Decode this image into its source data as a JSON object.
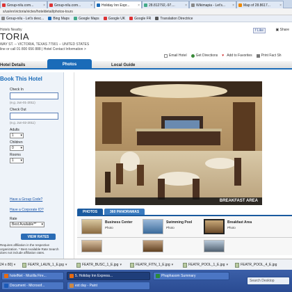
{
  "browser": {
    "tabs": [
      {
        "label": "Group-nilu.com...",
        "color": "#d33"
      },
      {
        "label": "Group-nilu.com...",
        "color": "#d33"
      },
      {
        "label": "Holiday Inn Expr...",
        "color": "#1a6bb8",
        "active": true
      },
      {
        "label": "28.812792,-97....",
        "color": "#4a8"
      },
      {
        "label": "Wikimapia - Let's...",
        "color": "#888"
      },
      {
        "label": "Map of 28.8617...",
        "color": "#e80"
      }
    ],
    "address": "s/us/en/victoria/victex/hoteldetail/photos-tours",
    "bookmarks": [
      {
        "label": "Group-nilu - Let's desc...",
        "color": "#888"
      },
      {
        "label": "Bing Maps",
        "color": "#1a6bb8"
      },
      {
        "label": "Google Maps",
        "color": "#4a8"
      },
      {
        "label": "Google UK",
        "color": "#d33"
      },
      {
        "label": "Google FR",
        "color": "#d33"
      },
      {
        "label": "Translation Directrice",
        "color": "#555"
      }
    ]
  },
  "page": {
    "hotels_nearby": "Hotels Nearby",
    "title": "TORIA",
    "address": "WAY ST. -- VICTORIA, TEXAS 77901 -- UNITED STATES",
    "phone": "line or call 01 800 656 888  |  Hotel Contact Information >",
    "like": "Like",
    "share": "Share",
    "actions": [
      "Email Hotel",
      "Get Directions",
      "Add to Favorites",
      "Print Fact Sh"
    ],
    "nav": {
      "details": "Hotel Details",
      "photos": "Photos",
      "local": "Local Guide"
    }
  },
  "booking": {
    "title": "Book This Hotel",
    "checkin_label": "Check In",
    "checkin_hint": "(e.g. Jun-01-2011)",
    "checkout_label": "Check Out",
    "checkout_hint": "(e.g. Jun-02-2011)",
    "adults_label": "Adults",
    "adults_value": "1",
    "children_label": "Children",
    "children_value": "0",
    "rooms_label": "Rooms",
    "rooms_value": "1",
    "group_code": "Have a Group Code?",
    "corporate_id": "Have a Corporate ID?",
    "rate_label": "Rate",
    "rate_value": "Best Available**",
    "view_rates": "VIEW RATES",
    "disclaimer": "Requires affiliation in the respective organization. * Best Available Rate Search does not include affiliation rates."
  },
  "photos": {
    "caption": "BREAKFAST AREA",
    "tabs": [
      "PHOTOS",
      "360 PANORAMAS"
    ],
    "thumbs": [
      {
        "title": "Business Center",
        "sub": "Photo"
      },
      {
        "title": "Swimming Pool",
        "sub": "Photo"
      },
      {
        "title": "Breakfast Area",
        "sub": "Photo"
      }
    ]
  },
  "downloads": [
    "FEATR_LAUN_1_E.jpg",
    "FEATR_BUSC_1_E.jpg",
    "FEATR_FITN_1_E.jpg",
    "FEATR_POOL_1_E.jpg",
    "FEATR_POOL_4_E.jpg"
  ],
  "downloads_left": "24 x 80]",
  "taskbar": {
    "row1": [
      {
        "label": "hotelNet - Mozilla Fire...",
        "color": "#e66a10"
      },
      {
        "label": "5. Holiday Inn Express...",
        "color": "#e66a10",
        "active": true
      },
      {
        "label": "Phaphasom Summary",
        "color": "#2a8a3a"
      }
    ],
    "row2": [
      {
        "label": "Document - Microsof...",
        "color": "#1a5ab8"
      },
      {
        "label": "ext day - Paint",
        "color": "#c84"
      },
      {
        "label": "Search Desktop",
        "color": "#3a7"
      }
    ]
  }
}
